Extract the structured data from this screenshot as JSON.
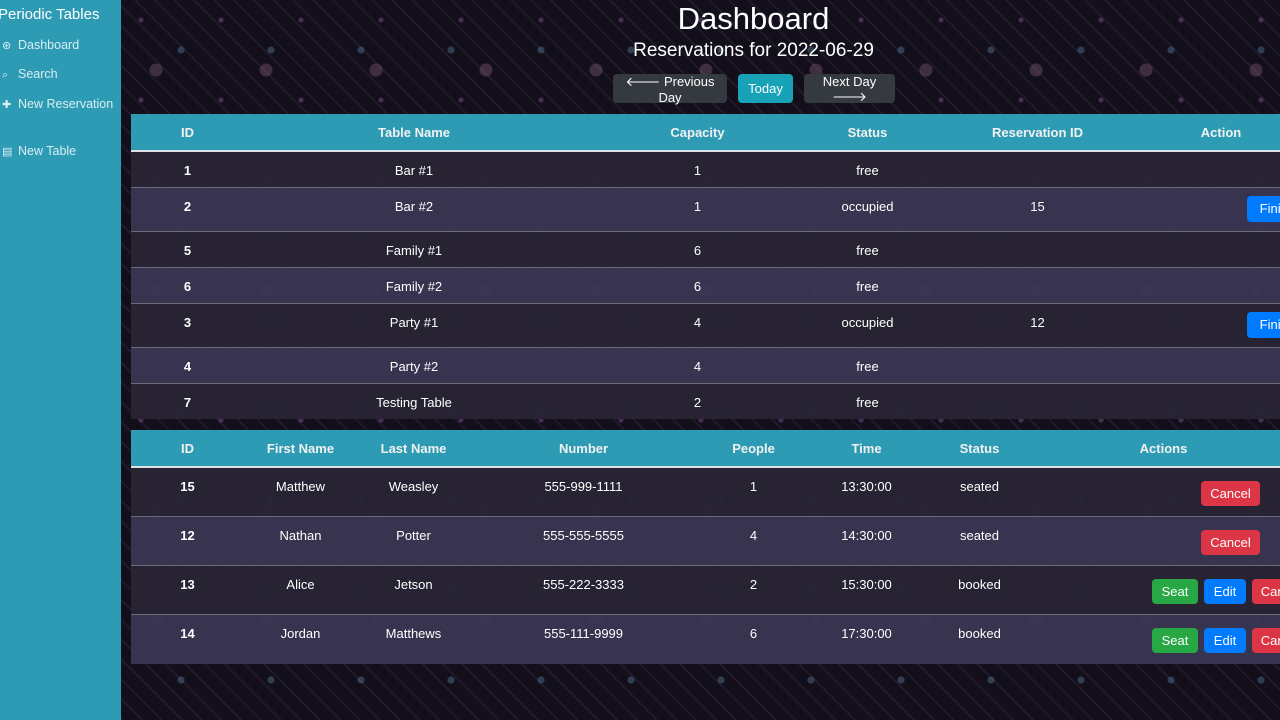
{
  "sidebar": {
    "brand": "Periodic Tables",
    "items": [
      {
        "label": "Dashboard",
        "icon": "dashboard-icon",
        "glyph": "⊛"
      },
      {
        "label": "Search",
        "icon": "search-icon",
        "glyph": "⌕"
      },
      {
        "label": "New Reservation",
        "icon": "plus-icon",
        "glyph": "✚"
      },
      {
        "label": "New Table",
        "icon": "table-icon",
        "glyph": "▤"
      }
    ]
  },
  "header": {
    "title": "Dashboard",
    "subtitle": "Reservations for 2022-06-29",
    "prev_label": "🡐 Previous Day",
    "today_label": "Today",
    "next_label": "Next Day 🡒"
  },
  "tables": {
    "columns": [
      "ID",
      "Table Name",
      "Capacity",
      "Status",
      "Reservation ID",
      "Action"
    ],
    "finish_label": "Finish",
    "rows": [
      {
        "id": "1",
        "name": "Bar #1",
        "capacity": "1",
        "status": "free",
        "reservation_id": ""
      },
      {
        "id": "2",
        "name": "Bar #2",
        "capacity": "1",
        "status": "occupied",
        "reservation_id": "15"
      },
      {
        "id": "5",
        "name": "Family #1",
        "capacity": "6",
        "status": "free",
        "reservation_id": ""
      },
      {
        "id": "6",
        "name": "Family #2",
        "capacity": "6",
        "status": "free",
        "reservation_id": ""
      },
      {
        "id": "3",
        "name": "Party #1",
        "capacity": "4",
        "status": "occupied",
        "reservation_id": "12"
      },
      {
        "id": "4",
        "name": "Party #2",
        "capacity": "4",
        "status": "free",
        "reservation_id": ""
      },
      {
        "id": "7",
        "name": "Testing Table",
        "capacity": "2",
        "status": "free",
        "reservation_id": ""
      }
    ]
  },
  "reservations": {
    "columns": [
      "ID",
      "First Name",
      "Last Name",
      "Number",
      "People",
      "Time",
      "Status",
      "Actions"
    ],
    "seat_label": "Seat",
    "edit_label": "Edit",
    "cancel_label": "Cancel",
    "rows": [
      {
        "id": "15",
        "first": "Matthew",
        "last": "Weasley",
        "number": "555-999-1111",
        "people": "1",
        "time": "13:30:00",
        "status": "seated"
      },
      {
        "id": "12",
        "first": "Nathan",
        "last": "Potter",
        "number": "555-555-5555",
        "people": "4",
        "time": "14:30:00",
        "status": "seated"
      },
      {
        "id": "13",
        "first": "Alice",
        "last": "Jetson",
        "number": "555-222-3333",
        "people": "2",
        "time": "15:30:00",
        "status": "booked"
      },
      {
        "id": "14",
        "first": "Jordan",
        "last": "Matthews",
        "number": "555-111-9999",
        "people": "6",
        "time": "17:30:00",
        "status": "booked"
      }
    ]
  },
  "colors": {
    "accent": "#2e9bb5",
    "danger": "#dc3545",
    "success": "#28a745",
    "primary": "#007bff",
    "dark_button": "#343a40"
  }
}
